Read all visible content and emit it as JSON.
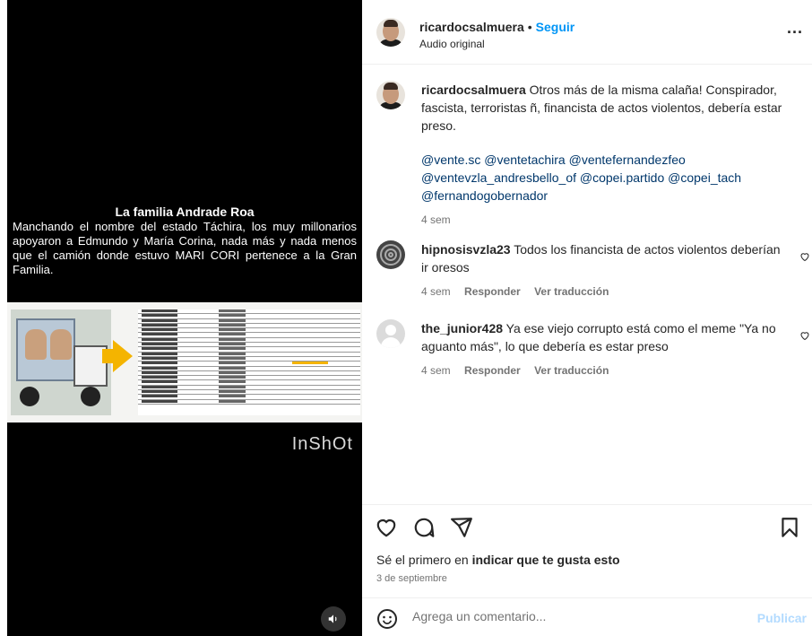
{
  "video": {
    "title": "La familia Andrade Roa",
    "body": "Manchando el nombre del estado Táchira, los muy millonarios apoyaron a Edmundo y María Corina, nada más y nada menos que el camión donde estuvo MARI CORI pertenece a la Gran Familia.",
    "watermark": "InShOt",
    "sound_icon": "speaker-icon"
  },
  "header": {
    "username": "ricardocsalmuera",
    "separator": "•",
    "follow_label": "Seguir",
    "audio_label": "Audio original",
    "more_label": "..."
  },
  "caption": {
    "username": "ricardocsalmuera",
    "text": "Otros más de la misma calaña! Conspirador, fascista, terroristas ñ, financista de actos violentos, debería estar preso.",
    "mentions": "@vente.sc @ventetachira @ventefernandezfeo @ventevzla_andresbello_of @copei.partido @copei_tach @fernandogobernador",
    "time": "4 sem"
  },
  "comments": [
    {
      "username": "hipnosisvzla23",
      "text": "Todos los financista de actos violentos deberían ir oresos",
      "time": "4 sem",
      "reply_label": "Responder",
      "translate_label": "Ver traducción"
    },
    {
      "username": "the_junior428",
      "text": "Ya ese viejo corrupto está como el meme \"Ya no aguanto más\", lo que debería es estar preso",
      "time": "4 sem",
      "reply_label": "Responder",
      "translate_label": "Ver traducción"
    }
  ],
  "actions": {
    "likes_prefix": "Sé el primero en ",
    "likes_link": "indicar que te gusta esto",
    "date": "3 de septiembre"
  },
  "composer": {
    "placeholder": "Agrega un comentario...",
    "publish_label": "Publicar"
  },
  "colors": {
    "link": "#0095f6",
    "mention": "#00376b",
    "muted": "#737373",
    "publish_disabled": "#b3dbff"
  }
}
